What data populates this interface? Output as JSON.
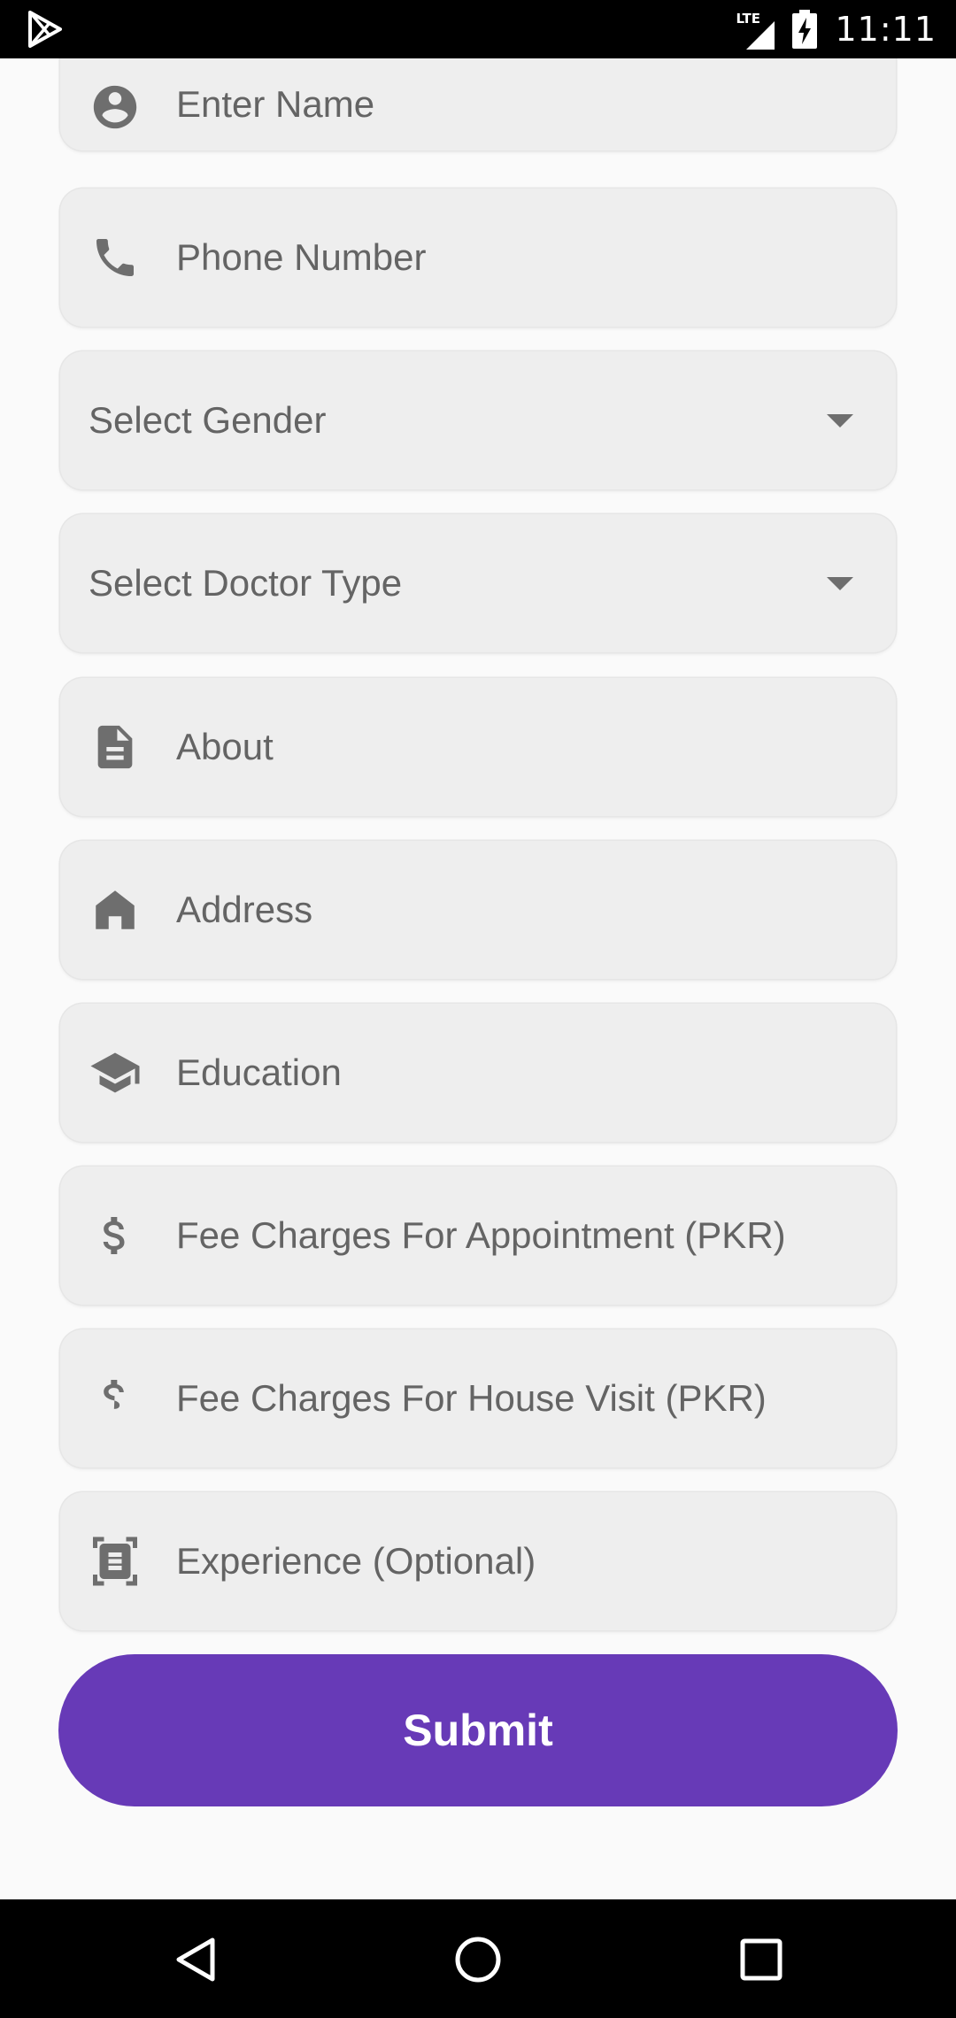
{
  "status_bar": {
    "network": "LTE",
    "time": "11:11",
    "icons": [
      "play-store-icon",
      "signal-icon",
      "battery-charging-icon"
    ]
  },
  "form": {
    "fields": [
      {
        "placeholder": "Enter Name",
        "icon": "account-circle-icon"
      },
      {
        "placeholder": "Phone Number",
        "icon": "phone-icon"
      },
      {
        "placeholder": "Select Gender",
        "icon": "arrow-drop-down-icon"
      },
      {
        "placeholder": "Select Doctor Type",
        "icon": "arrow-drop-down-icon"
      },
      {
        "placeholder": "About",
        "icon": "description-icon"
      },
      {
        "placeholder": "Address",
        "icon": "home-icon"
      },
      {
        "placeholder": "Education",
        "icon": "school-icon"
      },
      {
        "placeholder": "Fee Charges For Appointment (PKR)",
        "icon": "dollar-icon"
      },
      {
        "placeholder": "Fee Charges For House Visit (PKR)",
        "icon": "dollar-icon"
      },
      {
        "placeholder": "Experience (Optional)",
        "icon": "document-scanner-icon"
      }
    ],
    "submit_label": "Submit"
  },
  "nav_bar": {
    "icons": [
      "back-icon",
      "home-icon",
      "recents-icon"
    ]
  },
  "colors": {
    "accent": "#673ab7",
    "field_background": "#eeeeee",
    "placeholder_text": "#646464",
    "icon": "#6e6e6e"
  }
}
